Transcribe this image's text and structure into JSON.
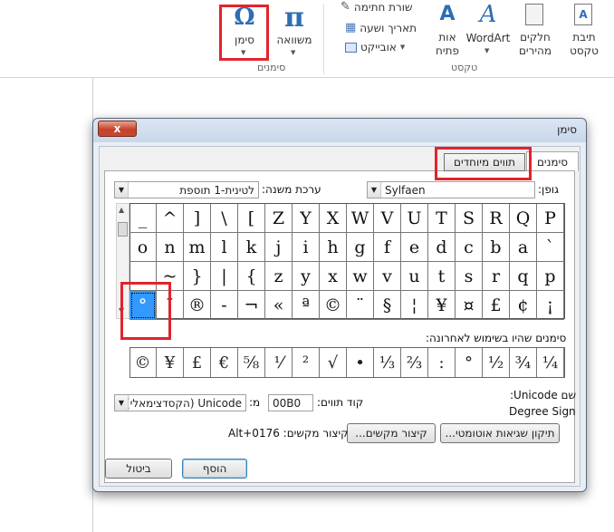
{
  "ribbon": {
    "symbol_btn": {
      "label": "סימן",
      "glyph": "Ω"
    },
    "equation_btn": {
      "label": "משוואה",
      "glyph": "π"
    },
    "symbols_group": "סימנים",
    "text_group": "טקסט",
    "signature_line": "שורת חתימה",
    "date_time": "תאריך ושעה",
    "object": "אובייקט",
    "dropcap_line1": "אות",
    "dropcap_line2": "פתיח",
    "dropcap_glyph": "A",
    "wordart": "WordArt",
    "wordart_glyph": "A",
    "quickparts_line1": "חלקים",
    "quickparts_line2": "מהירים",
    "textbox_line1": "תיבת",
    "textbox_line2": "טקסט"
  },
  "dialog": {
    "title": "סימן",
    "close": "x",
    "tabs": {
      "symbols": "סימנים",
      "special": "תווים מיוחדים"
    },
    "font_label": "גופן:",
    "font_value": "Sylfaen",
    "subset_label": "ערכת משנה:",
    "subset_value": "לטינית-1 תוספת",
    "grid": [
      [
        "P",
        "Q",
        "R",
        "S",
        "T",
        "U",
        "V",
        "W",
        "X",
        "Y",
        "Z",
        "[",
        "\\",
        "]",
        "^",
        "_"
      ],
      [
        "`",
        "a",
        "b",
        "c",
        "d",
        "e",
        "f",
        "g",
        "h",
        "i",
        "j",
        "k",
        "l",
        "m",
        "n",
        "o"
      ],
      [
        "p",
        "q",
        "r",
        "s",
        "t",
        "u",
        "v",
        "w",
        "x",
        "y",
        "z",
        "{",
        "|",
        "}",
        "~",
        ""
      ],
      [
        "¡",
        "¢",
        "£",
        "¤",
        "¥",
        "¦",
        "§",
        "¨",
        "©",
        "ª",
        "«",
        "¬",
        "-",
        "®",
        "¯",
        "°"
      ]
    ],
    "recent_label": "סימנים שהיו בשימוש לאחרונה:",
    "recent": [
      "¼",
      "¾",
      "½",
      "°",
      ":",
      "⅔",
      "⅓",
      "•",
      "√",
      "²",
      "⅟",
      "⅝",
      "€",
      "£",
      "¥",
      "©"
    ],
    "unicode_name_label": "שם Unicode:",
    "unicode_name": "Degree Sign",
    "char_code_label": "קוד תווים:",
    "char_code": "00B0",
    "from_label": "מ:",
    "from_value": "Unicode (הקסדצימאלי)",
    "autocorrect_btn": "תיקון שגיאות אוטומטי...",
    "shortcut_btn": "קיצור מקשים...",
    "shortcut_label": "קיצור מקשים: Alt+0176",
    "insert_btn": "הוסף",
    "cancel_btn": "ביטול"
  },
  "colors": {
    "highlight": "#e3232c",
    "selection": "#3399ff"
  }
}
